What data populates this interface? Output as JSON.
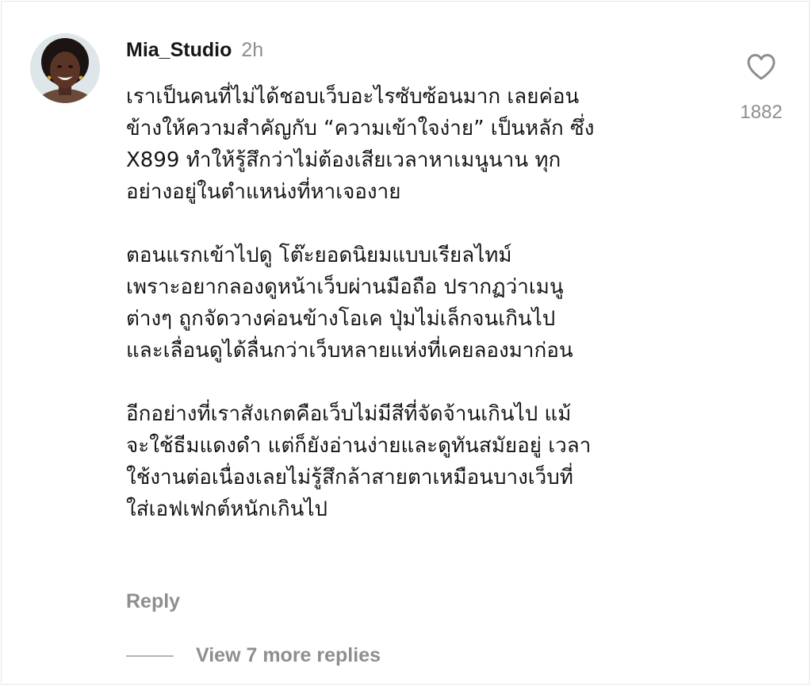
{
  "comment": {
    "username": "Mia_Studio",
    "time": "2h",
    "paragraphs": [
      "เราเป็นคนที่ไม่ได้ชอบเว็บอะไรซับซ้อนมาก เลยค่อน\nข้างให้ความสำคัญกับ “ความเข้าใจง่าย” เป็นหลัก ซึ่ง\nX899 ทำให้รู้สึกว่าไม่ต้องเสียเวลาหาเมนูนาน ทุก\nอย่างอยู่ในตำแหน่งที่หาเจองาย",
      "ตอนแรกเข้าไปดู โต๊ะยอดนิยมแบบเรียลไทม์\n เพราะอยากลองดูหน้าเว็บผ่านมือถือ ปรากฏว่าเมนู\nต่างๆ ถูกจัดวางค่อนข้างโอเค ปุ่มไม่เล็กจนเกินไป\nและเลื่อนดูได้ลื่นกว่าเว็บหลายแห่งที่เคยลองมาก่อน",
      "อีกอย่างที่เราสังเกตคือเว็บไม่มีสีที่จัดจ้านเกินไป แม้\nจะใช้ธีมแดงดำ แต่ก็ยังอ่านง่ายและดูทันสมัยอยู่ เวลา\nใช้งานต่อเนื่องเลยไม่รู้สึกล้าสายตาเหมือนบางเว็บที่\nใส่เอฟเฟกต์หนักเกินไป"
    ],
    "reply_label": "Reply",
    "view_more_label": "View 7 more replies",
    "like_count": "1882",
    "icons": {
      "like": "heart-outline-icon",
      "avatar": "avatar"
    },
    "colors": {
      "text": "#161616",
      "muted": "#8e8e8e"
    }
  }
}
